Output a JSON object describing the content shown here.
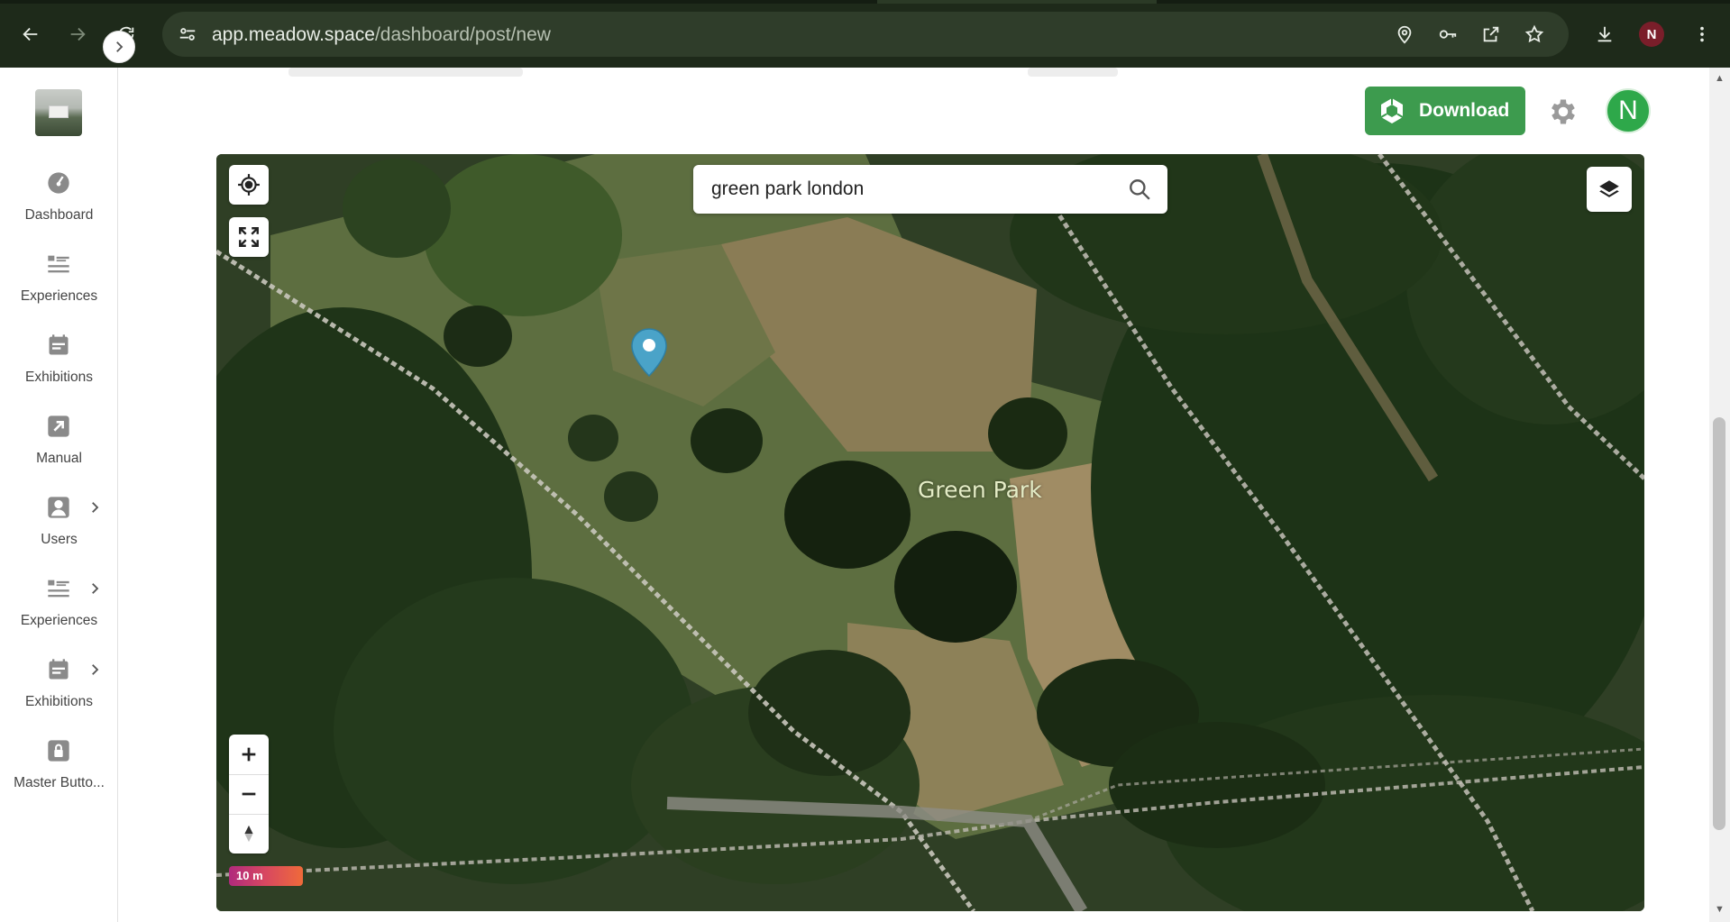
{
  "browser": {
    "url_host": "app.meadow.space",
    "url_path": "/dashboard/post/new",
    "profile_initial": "N"
  },
  "sidebar": {
    "items": [
      {
        "label": "Dashboard",
        "icon": "dashboard-icon",
        "has_submenu": false
      },
      {
        "label": "Experiences",
        "icon": "list-icon",
        "has_submenu": false
      },
      {
        "label": "Exhibitions",
        "icon": "calendar-icon",
        "has_submenu": false
      },
      {
        "label": "Manual",
        "icon": "external-link-icon",
        "has_submenu": false
      },
      {
        "label": "Users",
        "icon": "user-icon",
        "has_submenu": true
      },
      {
        "label": "Experiences",
        "icon": "list-icon",
        "has_submenu": true
      },
      {
        "label": "Exhibitions",
        "icon": "calendar-icon",
        "has_submenu": true
      },
      {
        "label": "Master Butto...",
        "icon": "lock-icon",
        "has_submenu": false
      }
    ]
  },
  "header": {
    "download_label": "Download",
    "avatar_initial": "N"
  },
  "map": {
    "search_value": "green park london",
    "search_placeholder": "",
    "place_label": "Green Park",
    "scale_label": "10 m"
  },
  "colors": {
    "download_green": "#3d9b4e",
    "avatar_green": "#2ea84a",
    "browser_chrome": "#1e2a1a",
    "marker_blue": "#4aa3c8"
  }
}
